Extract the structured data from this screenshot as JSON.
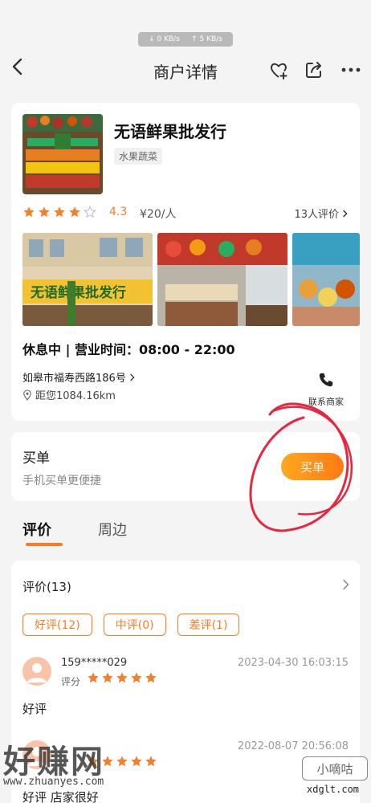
{
  "status_bar": {
    "down_speed": "↓ 0 KB/s",
    "up_speed": "↑ 5 KB/s"
  },
  "nav": {
    "title": "商户详情"
  },
  "shop": {
    "name": "无语鲜果批发行",
    "category": "水果蔬菜",
    "rating": "4.3",
    "price": "¥20/人",
    "review_count": "13人评价",
    "hours": "休息中 | 营业时间：08:00 - 22:00",
    "address": "如皋市福寿西路186号",
    "distance": "距您1084.16km",
    "contact_label": "联系商家"
  },
  "pay": {
    "title": "买单",
    "subtitle": "手机买单更便捷",
    "button": "买单"
  },
  "tabs": [
    {
      "label": "评价"
    },
    {
      "label": "周边"
    }
  ],
  "reviews": {
    "header": "评价(13)",
    "filters": [
      {
        "label": "好评(12)"
      },
      {
        "label": "中评(0)"
      },
      {
        "label": "差评(1)"
      }
    ],
    "items": [
      {
        "user": "159*****029",
        "score_label": "评分",
        "date": "2023-04-30 16:03:15",
        "text": "好评"
      },
      {
        "user": "",
        "score_label": "",
        "date": "2022-08-07 20:56:08",
        "text": "好评 店家很好"
      }
    ]
  },
  "watermarks": {
    "left_big": "好赚网",
    "left_url": "www.zhuanyes.com",
    "right_box": "小嘀咕",
    "right_url": "xdglt.com"
  },
  "colors": {
    "accent": "#ff7a1e",
    "star": "#f0822b",
    "annotation": "#e8263f"
  }
}
